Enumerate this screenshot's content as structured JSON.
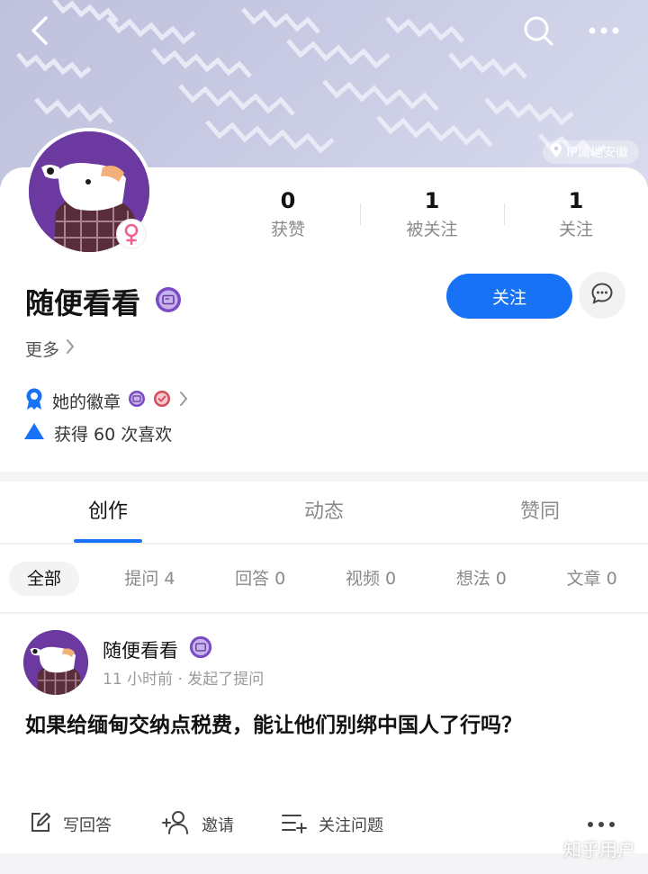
{
  "header": {
    "back_icon": "chevron-left-icon",
    "search_icon": "search-icon",
    "more_icon": "more-horizontal-icon",
    "ip_location": "IP属地安徽"
  },
  "profile": {
    "stats": [
      {
        "value": "0",
        "label": "获赞"
      },
      {
        "value": "1",
        "label": "被关注"
      },
      {
        "value": "1",
        "label": "关注"
      }
    ],
    "username": "随便看看",
    "follow_label": "关注",
    "more_label": "更多",
    "badges_label": "她的徽章",
    "likes_text": "获得 60 次喜欢",
    "colors": {
      "accent": "#1772f6",
      "avatar_bg": "#6b39a0",
      "gender": "#f06292"
    }
  },
  "tabs": [
    {
      "label": "创作",
      "active": true
    },
    {
      "label": "动态",
      "active": false
    },
    {
      "label": "赞同",
      "active": false
    }
  ],
  "filters": [
    {
      "label": "全部",
      "active": true
    },
    {
      "label": "提问 4",
      "active": false
    },
    {
      "label": "回答 0",
      "active": false
    },
    {
      "label": "视频 0",
      "active": false
    },
    {
      "label": "想法 0",
      "active": false
    },
    {
      "label": "文章 0",
      "active": false
    }
  ],
  "feed": {
    "author": "随便看看",
    "meta": "11 小时前 · 发起了提问",
    "title": "如果给缅甸交纳点税费，能让他们别绑中国人了行吗？",
    "actions": {
      "answer": "写回答",
      "invite": "邀请",
      "follow_question": "关注问题"
    }
  },
  "watermark": "知乎用户"
}
